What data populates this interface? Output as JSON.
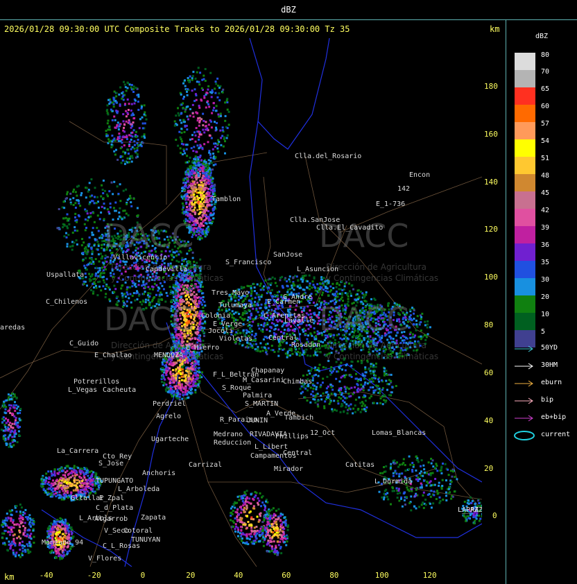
{
  "window_title": "dBZ",
  "status_line": "2026/01/28 09:30:00 UTC Composite Tracks to 2026/01/28 09:30:00 Tz 35",
  "axis_unit": "km",
  "y_ticks": [
    "180",
    "160",
    "140",
    "120",
    "100",
    "80",
    "60",
    "40",
    "20",
    "0"
  ],
  "x_ticks": [
    "-40",
    "-20",
    "0",
    "20",
    "40",
    "60",
    "80",
    "100",
    "120"
  ],
  "legend": {
    "title": "dBZ",
    "scale": [
      {
        "label": "80",
        "color": "#dcdcdc"
      },
      {
        "label": "70",
        "color": "#b4b4b4"
      },
      {
        "label": "65",
        "color": "#ff3020"
      },
      {
        "label": "60",
        "color": "#ff6a00"
      },
      {
        "label": "57",
        "color": "#ff9a5a"
      },
      {
        "label": "54",
        "color": "#ffff00"
      },
      {
        "label": "51",
        "color": "#ffc830"
      },
      {
        "label": "48",
        "color": "#d08830"
      },
      {
        "label": "45",
        "color": "#c87090"
      },
      {
        "label": "42",
        "color": "#e050a0"
      },
      {
        "label": "39",
        "color": "#c020a0"
      },
      {
        "label": "36",
        "color": "#7020d0"
      },
      {
        "label": "35",
        "color": "#2050e0"
      },
      {
        "label": "30",
        "color": "#1890e0"
      },
      {
        "label": "20",
        "color": "#108010"
      },
      {
        "label": "10",
        "color": "#006020"
      },
      {
        "label": "5",
        "color": "#404090"
      }
    ],
    "tracks": [
      {
        "label": "50YD",
        "color": "#40c8d8"
      },
      {
        "label": "30HM",
        "color": "#ffffff"
      },
      {
        "label": "eburn",
        "color": "#f0b040"
      },
      {
        "label": "bip",
        "color": "#ffb0c0"
      },
      {
        "label": "eb+bip",
        "color": "#d040d0"
      },
      {
        "label": "current",
        "color": "#20d0e0"
      }
    ]
  },
  "watermark": {
    "brand": "DACC",
    "line1": "Dirección de Agricultura",
    "line2": "y Contingencias Climáticas"
  },
  "places": [
    {
      "name": "Clla.del_Rosario"
    },
    {
      "name": "Encon"
    },
    {
      "name": "142"
    },
    {
      "name": "E_1-736"
    },
    {
      "name": "Tamblon"
    },
    {
      "name": "Clla.SanJose"
    },
    {
      "name": "Clla.El_Cavadito"
    },
    {
      "name": "Villavicencio"
    },
    {
      "name": "S_Francisco"
    },
    {
      "name": "SanJose"
    },
    {
      "name": "L_Asuncion"
    },
    {
      "name": "Uspallata"
    },
    {
      "name": "Capdevilla"
    },
    {
      "name": "Tres_Mayo"
    },
    {
      "name": "G_Andre"
    },
    {
      "name": "C_Chilenos"
    },
    {
      "name": "E_Carmen"
    },
    {
      "name": "Tulumaya"
    },
    {
      "name": "C_Arenitas"
    },
    {
      "name": "Lavalle"
    },
    {
      "name": "aredas"
    },
    {
      "name": "E_Verge"
    },
    {
      "name": "Colonia"
    },
    {
      "name": "Jocoli"
    },
    {
      "name": "Violetas"
    },
    {
      "name": "Central"
    },
    {
      "name": "Rosadon"
    },
    {
      "name": "C_Guido"
    },
    {
      "name": "E_Hierro"
    },
    {
      "name": "E_Challao"
    },
    {
      "name": "MENDOZA"
    },
    {
      "name": "F_L_Beltran"
    },
    {
      "name": "Chapanay"
    },
    {
      "name": "Chimbas"
    },
    {
      "name": "M_Casarini"
    },
    {
      "name": "Potrerillos"
    },
    {
      "name": "Cacheuta"
    },
    {
      "name": "L_Vegas"
    },
    {
      "name": "S_Roque"
    },
    {
      "name": "Palmira"
    },
    {
      "name": "S_MARTIN"
    },
    {
      "name": "Perdriel"
    },
    {
      "name": "Agrelo"
    },
    {
      "name": "A_Verde"
    },
    {
      "name": "Tambich"
    },
    {
      "name": "R_Paraiso"
    },
    {
      "name": "JUNIN"
    },
    {
      "name": "Ugarteche"
    },
    {
      "name": "Medrano"
    },
    {
      "name": "Reduccion"
    },
    {
      "name": "RIVADAVIA"
    },
    {
      "name": "Phillips"
    },
    {
      "name": "12_Oct"
    },
    {
      "name": "L_Libert"
    },
    {
      "name": "Campamentos"
    },
    {
      "name": "Central"
    },
    {
      "name": "LA_PAZ"
    },
    {
      "name": "Lomas_Blancas"
    },
    {
      "name": "La_Carrera"
    },
    {
      "name": "Cto_Rey"
    },
    {
      "name": "S_Jose"
    },
    {
      "name": "Carrizal"
    },
    {
      "name": "Anchoris"
    },
    {
      "name": "TUPUNGATO"
    },
    {
      "name": "L_Arboleda"
    },
    {
      "name": "Gltallar"
    },
    {
      "name": "E_Zpal"
    },
    {
      "name": "Mirador"
    },
    {
      "name": "Catitas"
    },
    {
      "name": "L_Dormida"
    },
    {
      "name": "C_d_Plata"
    },
    {
      "name": "L_Arbols"
    },
    {
      "name": "Zapata"
    },
    {
      "name": "Algarrob"
    },
    {
      "name": "V_Seco"
    },
    {
      "name": "Cotoral"
    },
    {
      "name": "TUNUYAN"
    },
    {
      "name": "Manzano_94"
    },
    {
      "name": "C_L_Rosas"
    },
    {
      "name": "V_Flores"
    },
    {
      "name": "L_PAZ"
    }
  ]
}
